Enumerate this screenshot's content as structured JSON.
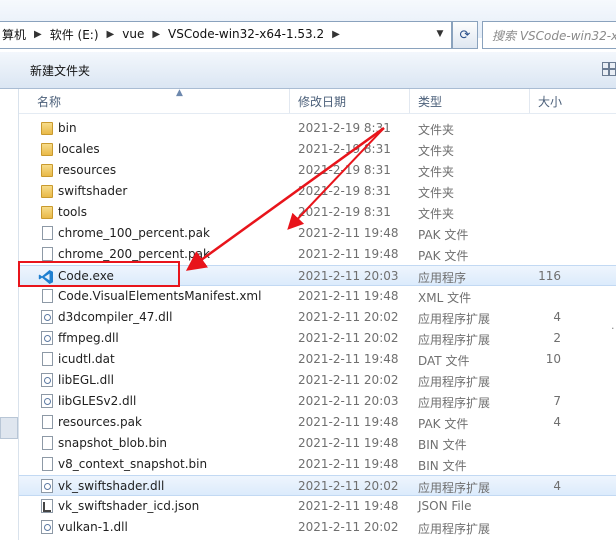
{
  "address": {
    "crumbs": [
      "算机",
      "软件 (E:)",
      "vue",
      "VSCode-win32-x64-1.53.2"
    ],
    "search_placeholder": "搜索 VSCode-win32-x"
  },
  "toolbar": {
    "new_folder": "新建文件夹"
  },
  "columns": {
    "name": "名称",
    "date": "修改日期",
    "type": "类型",
    "size": "大小"
  },
  "files": [
    {
      "name": "bin",
      "date": "2021-2-19 8:31",
      "type": "文件夹",
      "size": "",
      "icon": "folder-icon"
    },
    {
      "name": "locales",
      "date": "2021-2-19 8:31",
      "type": "文件夹",
      "size": "",
      "icon": "folder-icon"
    },
    {
      "name": "resources",
      "date": "2021-2-19 8:31",
      "type": "文件夹",
      "size": "",
      "icon": "folder-icon"
    },
    {
      "name": "swiftshader",
      "date": "2021-2-19 8:31",
      "type": "文件夹",
      "size": "",
      "icon": "folder-icon"
    },
    {
      "name": "tools",
      "date": "2021-2-19 8:31",
      "type": "文件夹",
      "size": "",
      "icon": "folder-icon"
    },
    {
      "name": "chrome_100_percent.pak",
      "date": "2021-2-11 19:48",
      "type": "PAK 文件",
      "size": "",
      "icon": "file-icon"
    },
    {
      "name": "chrome_200_percent.pak",
      "date": "2021-2-11 19:48",
      "type": "PAK 文件",
      "size": "",
      "icon": "file-icon"
    },
    {
      "name": "Code.exe",
      "date": "2021-2-11 20:03",
      "type": "应用程序",
      "size": "116",
      "icon": "vscode-icon",
      "selected": true
    },
    {
      "name": "Code.VisualElementsManifest.xml",
      "date": "2021-2-11 19:48",
      "type": "XML 文件",
      "size": "",
      "icon": "file-icon"
    },
    {
      "name": "d3dcompiler_47.dll",
      "date": "2021-2-11 20:02",
      "type": "应用程序扩展",
      "size": "4",
      "icon": "dll-icon"
    },
    {
      "name": "ffmpeg.dll",
      "date": "2021-2-11 20:02",
      "type": "应用程序扩展",
      "size": "2",
      "icon": "dll-icon"
    },
    {
      "name": "icudtl.dat",
      "date": "2021-2-11 19:48",
      "type": "DAT 文件",
      "size": "10",
      "icon": "file-icon"
    },
    {
      "name": "libEGL.dll",
      "date": "2021-2-11 20:02",
      "type": "应用程序扩展",
      "size": "",
      "icon": "dll-icon"
    },
    {
      "name": "libGLESv2.dll",
      "date": "2021-2-11 20:03",
      "type": "应用程序扩展",
      "size": "7",
      "icon": "dll-icon"
    },
    {
      "name": "resources.pak",
      "date": "2021-2-11 19:48",
      "type": "PAK 文件",
      "size": "4",
      "icon": "file-icon"
    },
    {
      "name": "snapshot_blob.bin",
      "date": "2021-2-11 19:48",
      "type": "BIN 文件",
      "size": "",
      "icon": "file-icon"
    },
    {
      "name": "v8_context_snapshot.bin",
      "date": "2021-2-11 19:48",
      "type": "BIN 文件",
      "size": "",
      "icon": "file-icon"
    },
    {
      "name": "vk_swiftshader.dll",
      "date": "2021-2-11 20:02",
      "type": "应用程序扩展",
      "size": "4",
      "icon": "dll-icon",
      "hover": true
    },
    {
      "name": "vk_swiftshader_icd.json",
      "date": "2021-2-11 19:48",
      "type": "JSON File",
      "size": "",
      "icon": "json-icon"
    },
    {
      "name": "vulkan-1.dll",
      "date": "2021-2-11 20:02",
      "type": "应用程序扩展",
      "size": "",
      "icon": "dll-icon"
    }
  ],
  "annotation_color": "#e8141b"
}
